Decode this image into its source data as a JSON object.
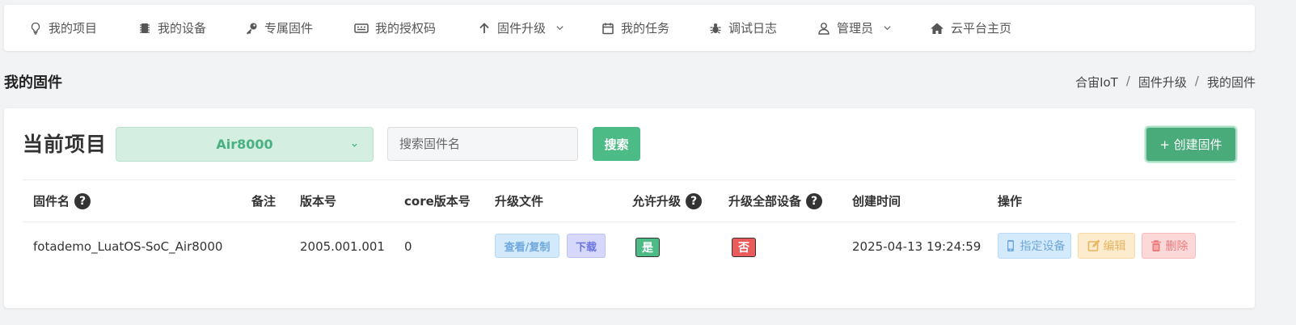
{
  "nav": {
    "items": [
      {
        "label": "我的项目",
        "icon": "lightbulb-icon"
      },
      {
        "label": "我的设备",
        "icon": "chip-icon"
      },
      {
        "label": "专属固件",
        "icon": "key-icon"
      },
      {
        "label": "我的授权码",
        "icon": "keyboard-icon"
      },
      {
        "label": "固件升级",
        "icon": "arrow-up-icon",
        "dropdown": true
      },
      {
        "label": "我的任务",
        "icon": "calendar-icon"
      },
      {
        "label": "调试日志",
        "icon": "bug-icon"
      },
      {
        "label": "管理员",
        "icon": "user-icon",
        "dropdown": true
      },
      {
        "label": "云平台主页",
        "icon": "home-icon"
      }
    ]
  },
  "page": {
    "title": "我的固件",
    "breadcrumb": [
      "合宙IoT",
      "固件升级",
      "我的固件"
    ]
  },
  "toolbar": {
    "project_label": "当前项目",
    "project_selected": "Air8000",
    "search_placeholder": "搜索固件名",
    "search_button": "搜索",
    "create_button": "+ 创建固件"
  },
  "table": {
    "headers": {
      "name": "固件名",
      "remark": "备注",
      "version": "版本号",
      "core_version": "core版本号",
      "upgrade_file": "升级文件",
      "allow_upgrade": "允许升级",
      "upgrade_all": "升级全部设备",
      "created_at": "创建时间",
      "actions": "操作"
    },
    "help_glyph": "?",
    "rows": [
      {
        "name": "fotademo_LuatOS-SoC_Air8000",
        "remark": "",
        "version": "2005.001.001",
        "core_version": "0",
        "view_copy": "查看/复制",
        "download": "下载",
        "allow_upgrade": "是",
        "upgrade_all": "否",
        "created_at": "2025-04-13 19:24:59",
        "assign": "指定设备",
        "edit": "编辑",
        "delete": "删除"
      }
    ]
  },
  "colors": {
    "primary_green": "#4cbb85",
    "danger_red": "#ea5c5c",
    "info_blue": "#6fa8dc",
    "warning_orange": "#e8b560"
  }
}
